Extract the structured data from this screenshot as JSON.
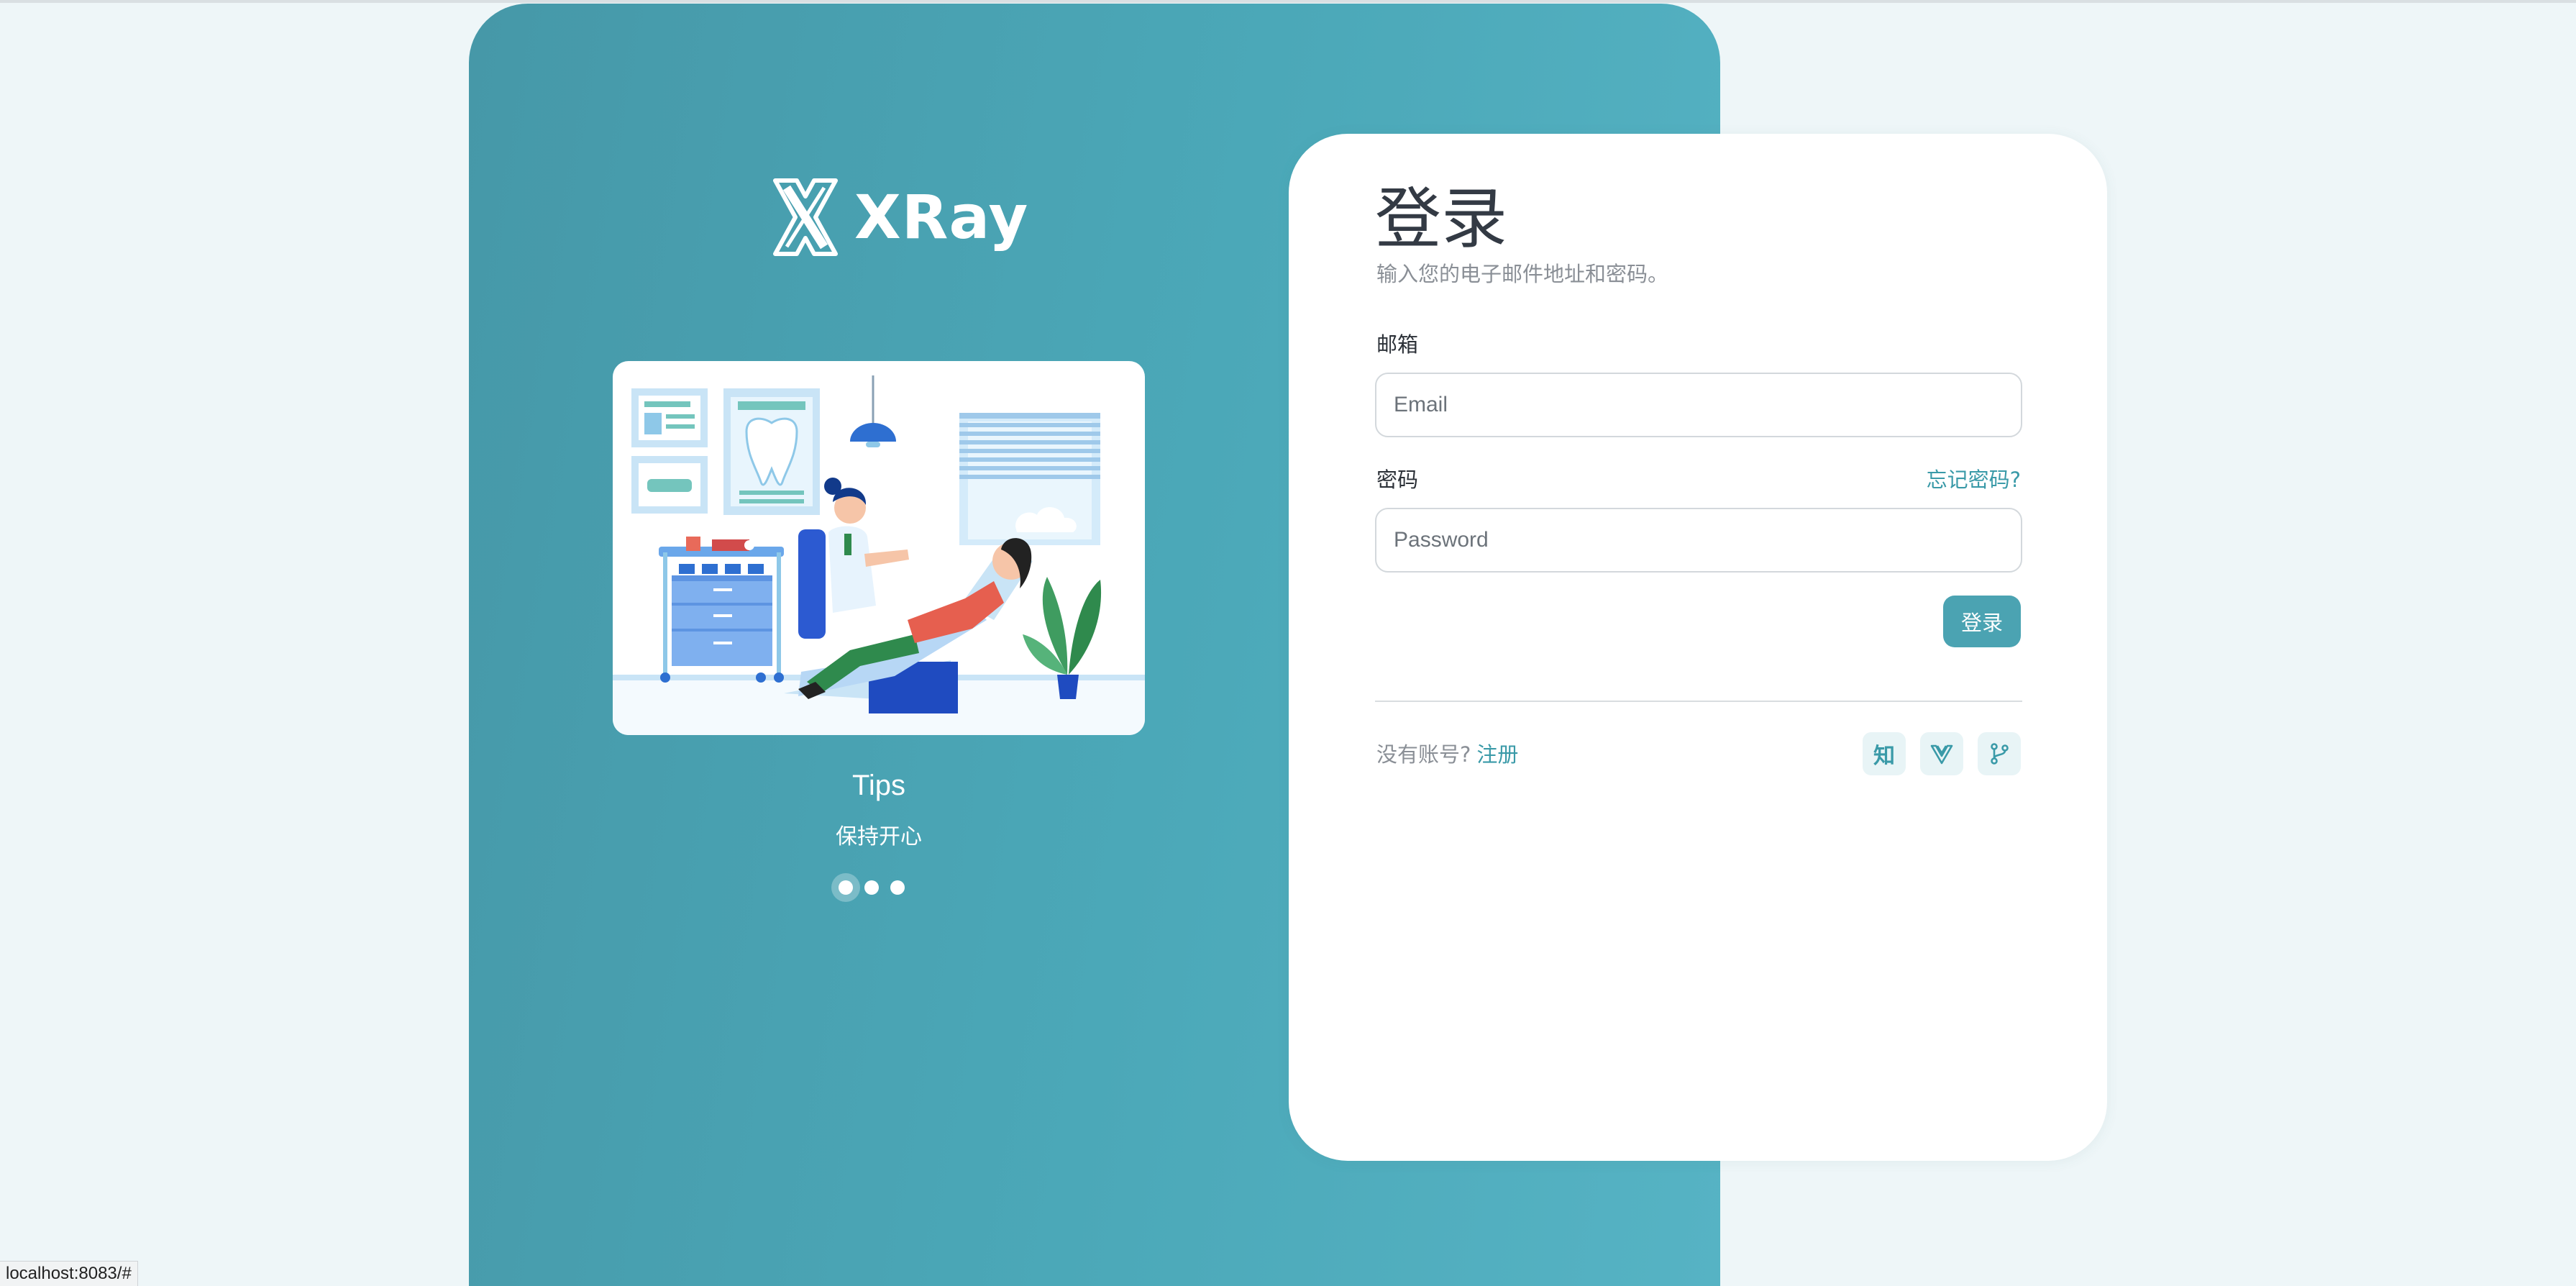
{
  "brand": {
    "name": "XRay",
    "logo_icon": "xray-logo-icon"
  },
  "colors": {
    "primary": "#4ba3b2",
    "link": "#3a9aa8",
    "panel_start": "#4698a8",
    "panel_end": "#56b3c4",
    "background": "#eef6f8"
  },
  "hero": {
    "illustration": "dentist-clinic-illustration",
    "tip_title": "Tips",
    "tip_text": "保持开心",
    "carousel_total": 3,
    "carousel_active": 1
  },
  "login": {
    "title": "登录",
    "subtitle": "输入您的电子邮件地址和密码。",
    "email_label": "邮箱",
    "email_placeholder": "Email",
    "email_value": "",
    "password_label": "密码",
    "password_placeholder": "Password",
    "password_value": "",
    "forgot_link": "忘记密码?",
    "submit_label": "登录"
  },
  "footer": {
    "no_account_text": "没有账号?",
    "register_link": "注册",
    "social": [
      {
        "icon": "zhihu-icon",
        "text": "知"
      },
      {
        "icon": "vue-icon"
      },
      {
        "icon": "git-branch-icon"
      }
    ]
  },
  "statusbar": {
    "url": "localhost:8083/#"
  }
}
